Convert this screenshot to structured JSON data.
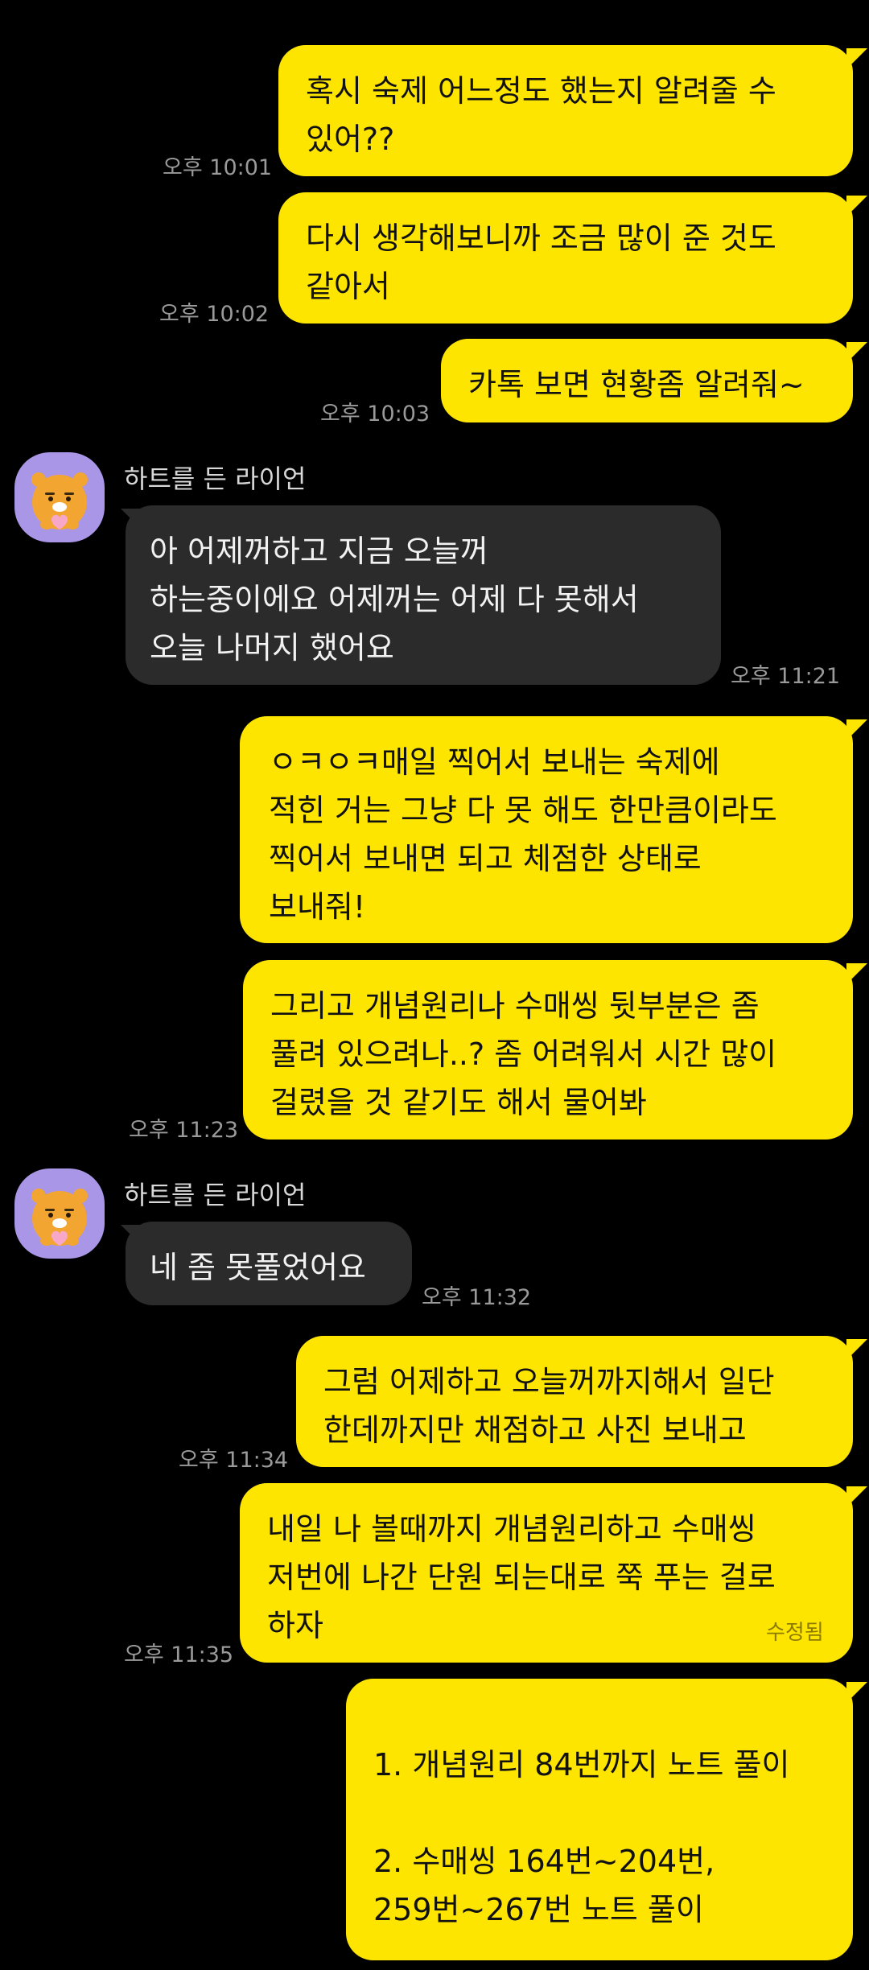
{
  "chat": {
    "sender_name": "하트를 든 라이언",
    "edited_label": "수정됨",
    "messages": [
      {
        "text": "혹시 숙제 어느정도 했는지 알려줄 수\n있어??",
        "time": "오후 10:01"
      },
      {
        "text": "다시 생각해보니까 조금 많이 준 것도\n같아서",
        "time": "오후 10:02"
      },
      {
        "text": "카톡 보면 현황좀 알려줘~",
        "time": "오후 10:03"
      },
      {
        "text": "아 어제꺼하고 지금 오늘꺼\n하는중이에요 어제꺼는 어제 다 못해서\n오늘 나머지 했어요",
        "time": "오후 11:21"
      },
      {
        "text": "ㅇㅋㅇㅋ매일 찍어서 보내는 숙제에\n적힌 거는 그냥 다 못 해도 한만큼이라도\n찍어서 보내면 되고 체점한 상태로\n보내줘!",
        "time": ""
      },
      {
        "text": "그리고 개념원리나 수매씽 뒷부분은 좀\n풀려 있으려나..? 좀 어려워서 시간 많이\n걸렸을 것 같기도 해서 물어봐",
        "time": "오후 11:23"
      },
      {
        "text": "네 좀 못풀었어요",
        "time": "오후 11:32"
      },
      {
        "text": "그럼 어제하고 오늘꺼까지해서 일단\n한데까지만 채점하고 사진 보내고",
        "time": "오후 11:34"
      },
      {
        "text": "내일 나 볼때까지 개념원리하고 수매씽\n저번에 나간 단원 되는대로 쭉 푸는 걸로\n하자",
        "time": "오후 11:35"
      },
      {
        "text": "1. 개념원리 84번까지 노트 풀이\n\n2. 수매씽 164번~204번,\n259번~267번 노트 풀이",
        "time": ""
      }
    ]
  },
  "colors": {
    "my_bubble": "#FEE500",
    "other_bubble": "#2b2b2b",
    "background": "#000000",
    "avatar_bg": "#a996e6"
  },
  "icons": {
    "avatar": "ryan-holding-heart-icon"
  }
}
